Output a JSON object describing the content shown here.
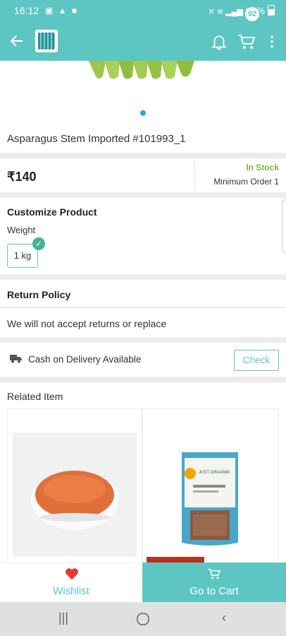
{
  "status_bar": {
    "time": "16:12",
    "battery": "65%"
  },
  "app_bar": {
    "cart_count": "92"
  },
  "product": {
    "name": "Asparagus Stem Imported #101993_1",
    "price": "₹140",
    "stock_status": "In Stock",
    "min_order": "Minimum Order 1"
  },
  "customize": {
    "title": "Customize Product",
    "weight_label": "Weight",
    "selected_option": "1 kg"
  },
  "return_policy": {
    "title": "Return Policy",
    "text": "We will not accept returns or replace"
  },
  "cod": {
    "text": "Cash on Delivery Available",
    "button_label": "Check"
  },
  "related": {
    "title": "Related Item",
    "pouch_brand": "JUST ORGANIK"
  },
  "bottom_bar": {
    "wishlist_label": "Wishlist",
    "cart_label": "Go to Cart"
  },
  "colors": {
    "primary": "#5dc6c2",
    "stock_green": "#7cb342",
    "wish_red": "#e53935"
  },
  "icons": [
    "back-arrow-icon",
    "bell-icon",
    "cart-icon",
    "more-vert-icon",
    "truck-icon",
    "heart-icon",
    "check-icon"
  ]
}
